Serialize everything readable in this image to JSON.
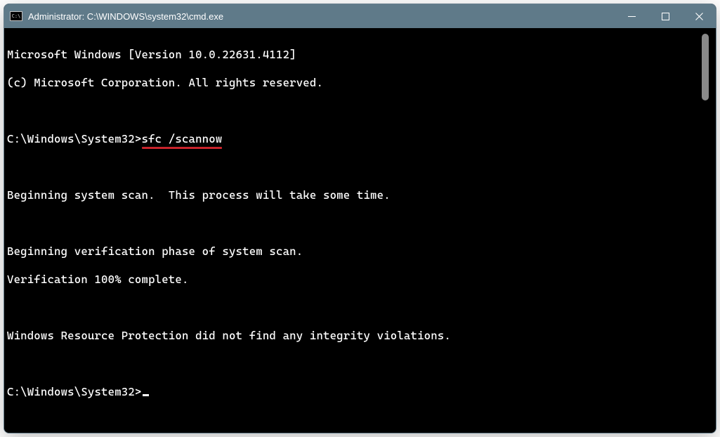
{
  "titlebar": {
    "title": "Administrator: C:\\WINDOWS\\system32\\cmd.exe"
  },
  "terminal": {
    "version_line": "Microsoft Windows [Version 10.0.22631.4112]",
    "copyright_line": "(c) Microsoft Corporation. All rights reserved.",
    "prompt1_prefix": "C:\\Windows\\System32>",
    "prompt1_command": "sfc /scannow",
    "scan_begin": "Beginning system scan.  This process will take some time.",
    "verify_begin": "Beginning verification phase of system scan.",
    "verify_done": "Verification 100% complete.",
    "result": "Windows Resource Protection did not find any integrity violations.",
    "prompt2_prefix": "C:\\Windows\\System32>"
  }
}
